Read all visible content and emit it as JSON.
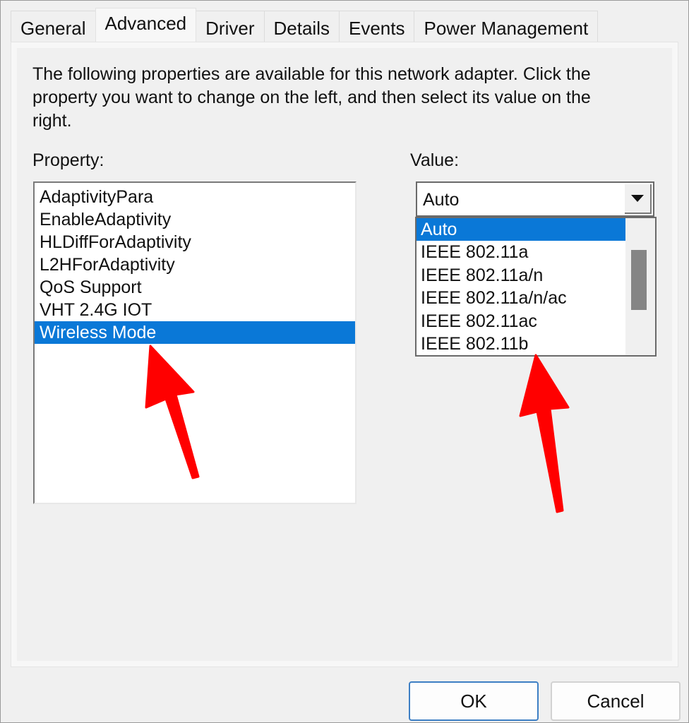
{
  "tabs": [
    {
      "label": "General",
      "active": false
    },
    {
      "label": "Advanced",
      "active": true
    },
    {
      "label": "Driver",
      "active": false
    },
    {
      "label": "Details",
      "active": false
    },
    {
      "label": "Events",
      "active": false
    },
    {
      "label": "Power Management",
      "active": false
    }
  ],
  "description": "The following properties are available for this network adapter. Click the property you want to change on the left, and then select its value on the right.",
  "property": {
    "label": "Property:",
    "items": [
      "AdaptivityPara",
      "EnableAdaptivity",
      "HLDiffForAdaptivity",
      "L2HForAdaptivity",
      "QoS Support",
      "VHT 2.4G IOT",
      "Wireless Mode"
    ],
    "selected": "Wireless Mode"
  },
  "value": {
    "label": "Value:",
    "current": "Auto",
    "dropdown_icon": "chevron-down-icon",
    "options": [
      "Auto",
      "IEEE 802.11a",
      "IEEE 802.11a/n",
      "IEEE 802.11a/n/ac",
      "IEEE 802.11ac",
      "IEEE 802.11b"
    ],
    "highlighted": "Auto",
    "scroll_thumb_fraction": 0.44,
    "scroll_position_fraction": 0.23
  },
  "annotations": {
    "arrow_color": "#ff0000"
  },
  "buttons": {
    "ok": "OK",
    "cancel": "Cancel"
  },
  "colors": {
    "selection": "#0a78d7",
    "background": "#f0f0f0"
  }
}
